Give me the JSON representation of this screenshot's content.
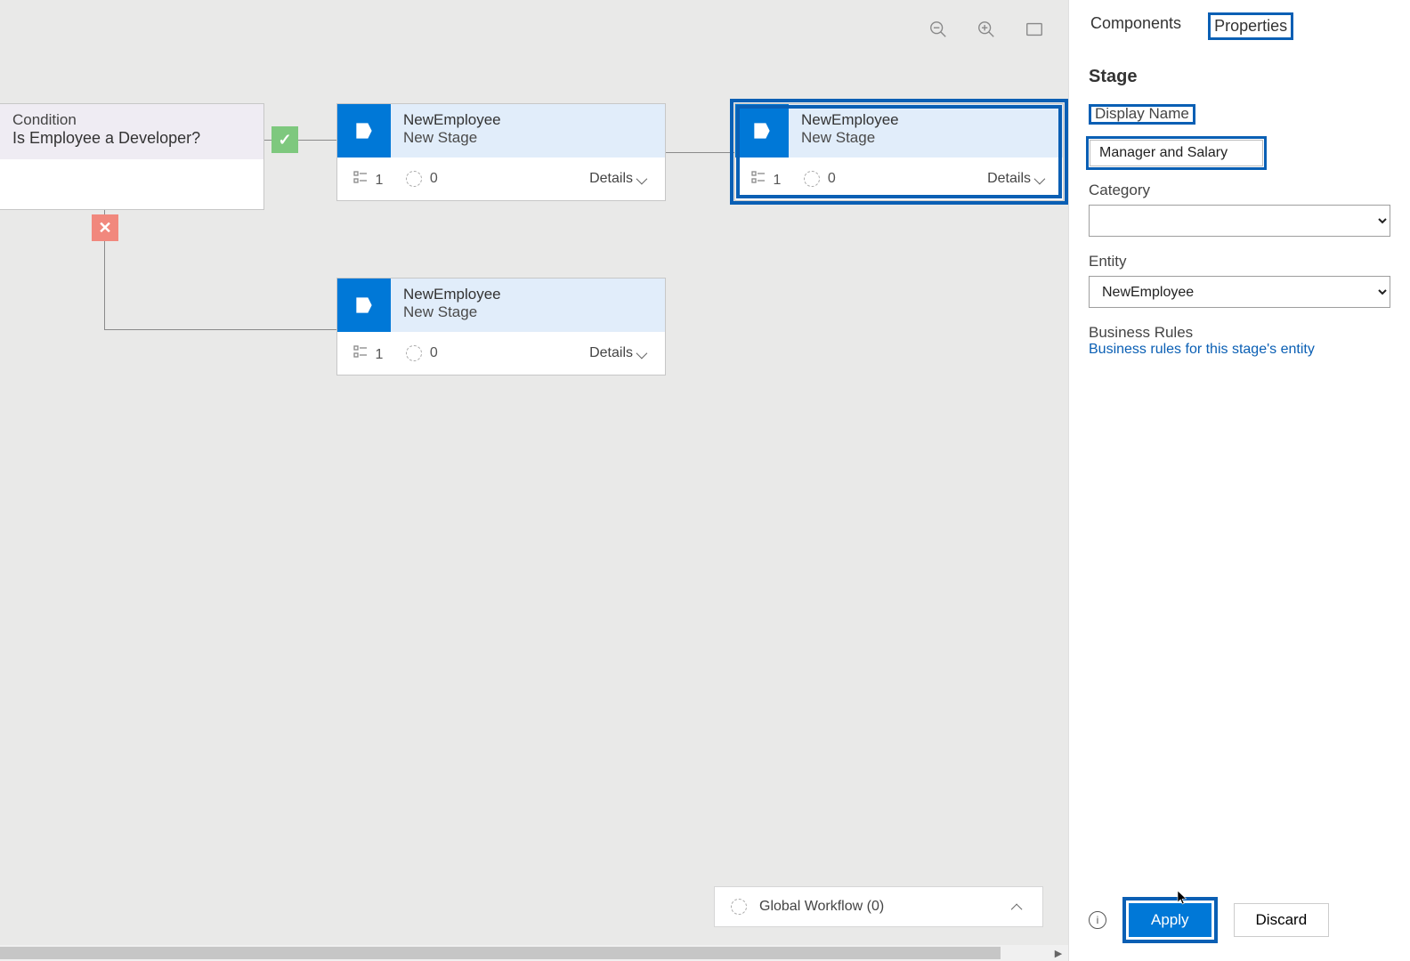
{
  "tabs": {
    "components": "Components",
    "properties": "Properties"
  },
  "panel": {
    "section": "Stage",
    "display_name_label": "Display Name",
    "display_name_value": "Manager and Salary",
    "category_label": "Category",
    "category_value": "",
    "entity_label": "Entity",
    "entity_value": "NewEmployee",
    "rules_heading": "Business Rules",
    "rules_link": "Business rules for this stage's entity",
    "apply": "Apply",
    "discard": "Discard"
  },
  "condition": {
    "type": "Condition",
    "text": "Is Employee a Developer?"
  },
  "stages": [
    {
      "entity": "NewEmployee",
      "name": "New Stage",
      "steps": "1",
      "triggers": "0",
      "details": "Details"
    },
    {
      "entity": "NewEmployee",
      "name": "New Stage",
      "steps": "1",
      "triggers": "0",
      "details": "Details"
    },
    {
      "entity": "NewEmployee",
      "name": "New Stage",
      "steps": "1",
      "triggers": "0",
      "details": "Details"
    }
  ],
  "workflow_bar": "Global Workflow (0)"
}
